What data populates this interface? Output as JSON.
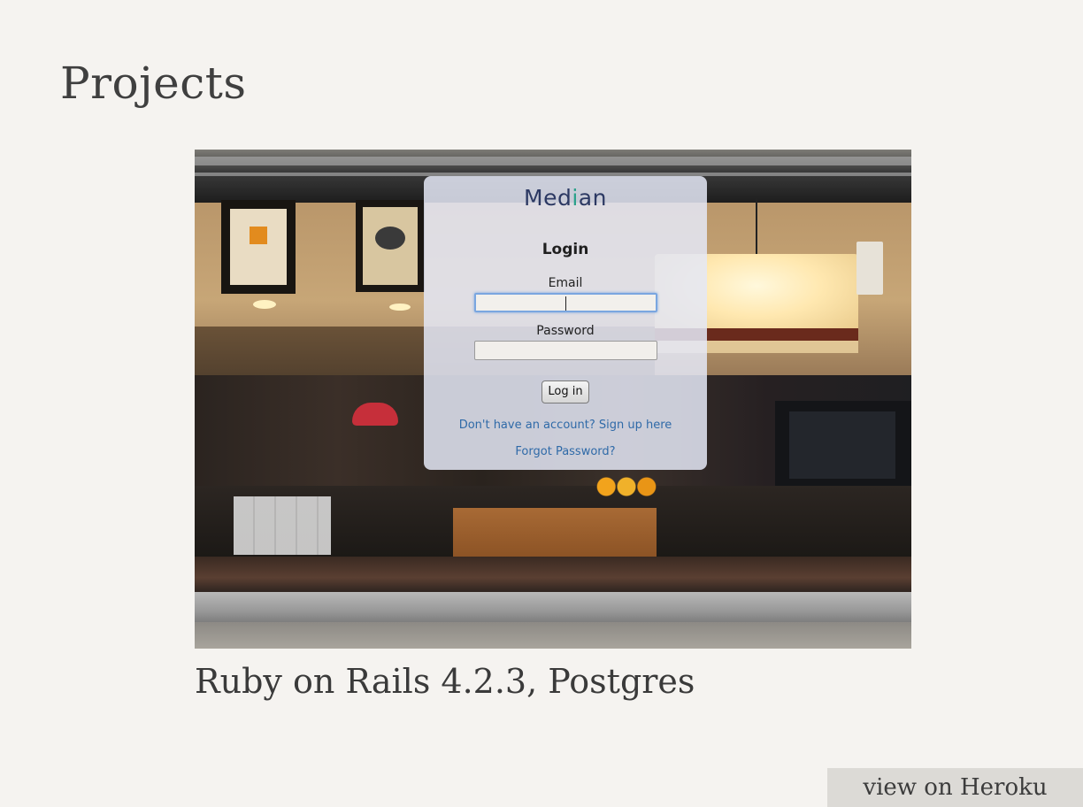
{
  "page": {
    "title": "Projects"
  },
  "project": {
    "screenshot": {
      "brand": "Median",
      "login_heading": "Login",
      "email_label": "Email",
      "email_value": "",
      "password_label": "Password",
      "password_value": "",
      "login_button": "Log in",
      "signup_link": "Don't have an account? Sign up here",
      "forgot_link": "Forgot Password?"
    },
    "caption": "Ruby on Rails 4.2.3, Postgres",
    "link_label": "view on Heroku"
  },
  "colors": {
    "page_background": "#f5f3f0",
    "heading_text": "#3f3f3f",
    "brand_navy": "#2c3963",
    "brand_pin_teal": "#2aa18a",
    "link_blue": "#2f6aa8",
    "heroku_button_bg": "#dcdad6"
  }
}
